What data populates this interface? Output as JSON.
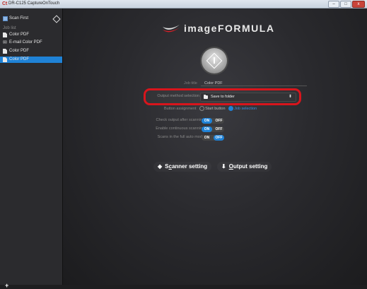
{
  "window": {
    "title": "DR-C125 CaptureOnTouch",
    "app_icon": "Ct",
    "minimize": "–",
    "maximize": "□",
    "close": "x"
  },
  "sidebar": {
    "scan_first": "Scan First",
    "job_list_label": "Job list",
    "items": [
      {
        "label": "Color PDF",
        "icon": "document-icon",
        "selected": false
      },
      {
        "label": "E-mail Color PDF",
        "icon": "email-icon",
        "selected": false
      },
      {
        "label": "Color PDF",
        "icon": "document-icon",
        "selected": false
      },
      {
        "label": "Color PDF",
        "icon": "document-icon",
        "selected": true
      }
    ],
    "add_button": "+"
  },
  "main": {
    "brand": "imageFORMULA",
    "job_title_label": "Job title",
    "job_title_value": "Color PDF",
    "output_method_label": "Output method selection",
    "output_method_value": "Save to folder",
    "output_method_caret": "⬍",
    "partial_label": "Button assignment",
    "partial_opt1": "Start button",
    "partial_opt2": "Job selection",
    "check_output_label": "Check output after scanning",
    "enable_continuous_label": "Enable continuous scanning",
    "full_auto_label": "Scans in the full auto mode",
    "toggle_on": "ON",
    "toggle_off": "OFF",
    "scanner_setting_prefix": "S",
    "scanner_setting_ul": "c",
    "scanner_setting_rest": "anner setting",
    "output_setting_ul": "O",
    "output_setting_rest": "utput setting"
  },
  "colors": {
    "accent_blue": "#1f82d6",
    "highlight_red": "#d8151c",
    "background": "#2a2a2e"
  }
}
